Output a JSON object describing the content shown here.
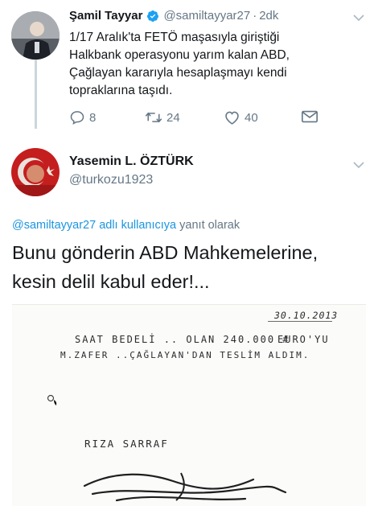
{
  "tweet": {
    "display_name": "Şamil Tayyar",
    "handle": "@samiltayyar27",
    "separator": "·",
    "time": "2dk",
    "text_line1": "1/17 Aralık'ta FETÖ maşasıyla giriştiği",
    "text_line2": "Halkbank operasyonu yarım kalan ABD,",
    "text_line3": "Çağlayan kararıyla hesaplaşmayı kendi",
    "text_line4": "topraklarına taşıdı.",
    "replies": "8",
    "retweets": "24",
    "likes": "40"
  },
  "reply": {
    "display_name": "Yasemin L. ÖZTÜRK",
    "handle": "@turkozu1923",
    "context_mention": "@samiltayyar27 adlı kullanıcıya",
    "context_suffix": "yanıt olarak",
    "text_line1": "Bunu gönderin ABD Mahkemelerine,",
    "text_line2": "kesin delil kabul eder!..."
  },
  "document": {
    "date": "30.10.2013",
    "line1_a": "SAAT BEDELİ .. OLAN 240.000 #",
    "line1_b": "EURO'YU",
    "line2": "M.ZAFER ..ÇAĞLAYAN'DAN TESLİM ALDIM.",
    "signer": "RIZA SARRAF"
  },
  "colors": {
    "verified": "#1da1f2",
    "link": "#1b95e0",
    "muted": "#657786",
    "thread_line": "#ccd6dd"
  },
  "icons": [
    "verified-badge-icon",
    "reply-icon",
    "retweet-icon",
    "like-icon",
    "direct-message-icon",
    "chevron-down-icon"
  ]
}
